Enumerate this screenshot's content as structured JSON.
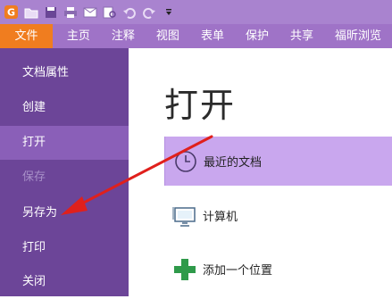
{
  "quick_access": {
    "icons": [
      "app-logo-icon",
      "open-folder-icon",
      "save-icon",
      "print-icon",
      "email-icon",
      "print-preview-icon",
      "undo-icon",
      "redo-icon",
      "customize-dropdown-icon"
    ]
  },
  "ribbon": {
    "tabs": [
      "文件",
      "主页",
      "注释",
      "视图",
      "表单",
      "保护",
      "共享",
      "福昕浏览"
    ]
  },
  "nav": {
    "items": [
      {
        "label": "文档属性",
        "state": "normal"
      },
      {
        "label": "创建",
        "state": "normal"
      },
      {
        "label": "打开",
        "state": "active"
      },
      {
        "label": "保存",
        "state": "disabled"
      },
      {
        "label": "另存为",
        "state": "normal"
      },
      {
        "label": "打印",
        "state": "normal"
      },
      {
        "label": "关闭",
        "state": "normal"
      }
    ]
  },
  "main": {
    "title": "打开",
    "options": [
      {
        "label": "最近的文档",
        "icon": "clock-icon"
      },
      {
        "label": "计算机",
        "icon": "computer-icon"
      },
      {
        "label": "添加一个位置",
        "icon": "plus-icon"
      }
    ]
  },
  "colors": {
    "toolbar": "#a983cf",
    "ribbon": "#9f73c7",
    "file_tab": "#f07d1f",
    "nav_bg": "#6c4598",
    "nav_active": "#8a5fb8",
    "recent_highlight": "#c9a7ee",
    "annotation_arrow": "#e0201c"
  }
}
